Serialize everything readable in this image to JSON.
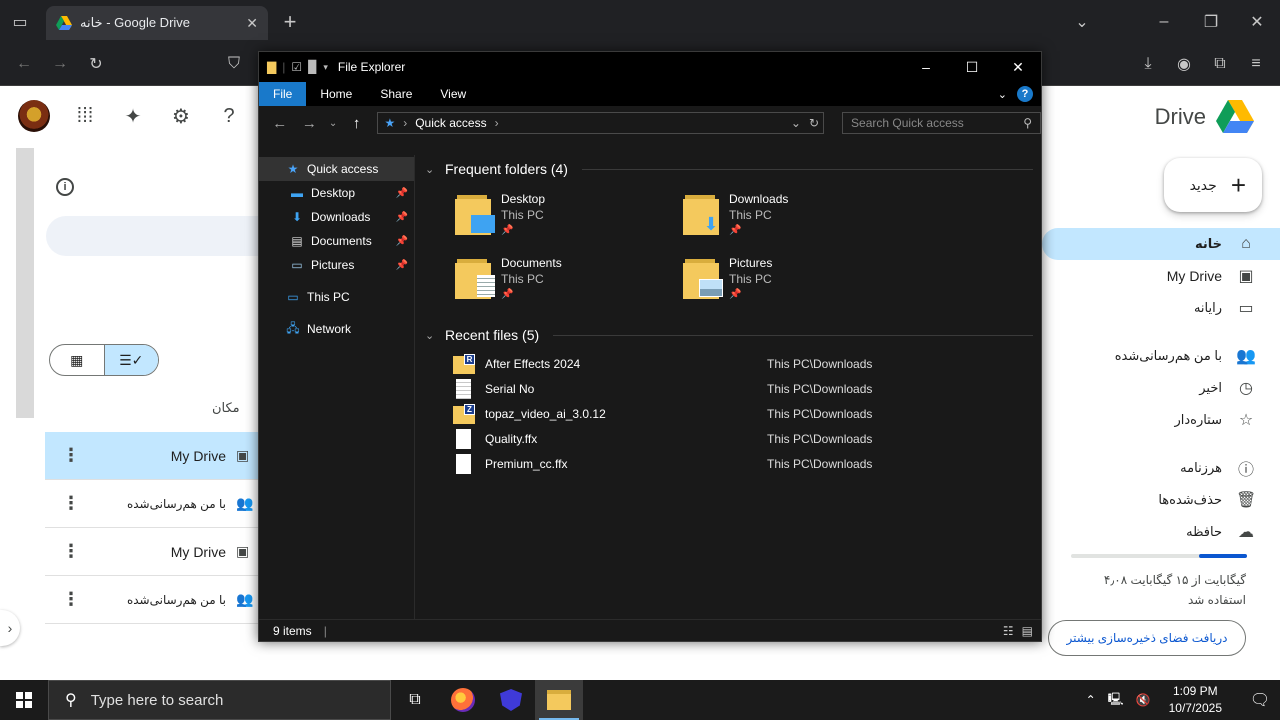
{
  "browser": {
    "tab_title": "خانه - Google Drive",
    "new_tab_symbol": "+"
  },
  "drive": {
    "logo_text": "Drive",
    "new_button_label": "جدید",
    "column_header": "مکان",
    "rows": [
      {
        "location": "My Drive",
        "icon": "drive-icon",
        "selected": true
      },
      {
        "location": "با من هم‌رسانی‌شده",
        "icon": "people-icon",
        "selected": false
      },
      {
        "location": "My Drive",
        "icon": "drive-icon",
        "selected": false
      },
      {
        "location": "با من هم‌رسانی‌شده",
        "icon": "people-icon",
        "selected": false
      }
    ],
    "nav": [
      {
        "label": "خانه",
        "icon": "home-icon",
        "active": true
      },
      {
        "label": "My Drive",
        "icon": "drive-icon",
        "active": false
      },
      {
        "label": "رایانه",
        "icon": "computer-icon",
        "active": false
      },
      {
        "label": "با من هم‌رسانی‌شده",
        "icon": "people-icon",
        "active": false
      },
      {
        "label": "اخیر",
        "icon": "clock-icon",
        "active": false
      },
      {
        "label": "ستاره‌دار",
        "icon": "star-icon",
        "active": false
      },
      {
        "label": "هرزنامه",
        "icon": "spam-icon",
        "active": false
      },
      {
        "label": "حذف‌شده‌ها",
        "icon": "trash-icon",
        "active": false
      },
      {
        "label": "حافظه",
        "icon": "cloud-icon",
        "active": false
      }
    ],
    "storage_used_fraction": 0.27,
    "storage_line1": "۴٫۰۸ گیگابایت از ۱۵ گیگابایت",
    "storage_line2": "استفاده شد",
    "storage_button": "دریافت فضای ذخیره‌سازی بیشتر",
    "accent_color": "#c2e7ff"
  },
  "explorer": {
    "window_title": "File Explorer",
    "ribbon_tabs": [
      "File",
      "Home",
      "Share",
      "View"
    ],
    "address_location": "Quick access",
    "search_placeholder": "Search Quick access",
    "sidebar": [
      {
        "label": "Quick access",
        "icon": "star-icon",
        "pinned": false,
        "selected": true
      },
      {
        "label": "Desktop",
        "icon": "desktop-icon",
        "pinned": true,
        "selected": false
      },
      {
        "label": "Downloads",
        "icon": "download-icon",
        "pinned": true,
        "selected": false
      },
      {
        "label": "Documents",
        "icon": "documents-icon",
        "pinned": true,
        "selected": false
      },
      {
        "label": "Pictures",
        "icon": "pictures-icon",
        "pinned": true,
        "selected": false
      },
      {
        "label": "This PC",
        "icon": "computer-icon",
        "pinned": false,
        "selected": false
      },
      {
        "label": "Network",
        "icon": "network-icon",
        "pinned": false,
        "selected": false
      }
    ],
    "frequent_header": "Frequent folders (4)",
    "frequent_folders": [
      {
        "name": "Desktop",
        "location": "This PC"
      },
      {
        "name": "Downloads",
        "location": "This PC"
      },
      {
        "name": "Documents",
        "location": "This PC"
      },
      {
        "name": "Pictures",
        "location": "This PC"
      }
    ],
    "recent_header": "Recent files (5)",
    "recent_files": [
      {
        "name": "After Effects 2024",
        "path": "This PC\\Downloads",
        "type": "zip-icon",
        "tag": "R"
      },
      {
        "name": "Serial No",
        "path": "This PC\\Downloads",
        "type": "text-file-icon",
        "tag": ""
      },
      {
        "name": "topaz_video_ai_3.0.12",
        "path": "This PC\\Downloads",
        "type": "zip-icon",
        "tag": "Z"
      },
      {
        "name": "Quality.ffx",
        "path": "This PC\\Downloads",
        "type": "file-icon",
        "tag": ""
      },
      {
        "name": "Premium_cc.ffx",
        "path": "This PC\\Downloads",
        "type": "file-icon",
        "tag": ""
      }
    ],
    "status_count": "9 items"
  },
  "taskbar": {
    "search_placeholder": "Type here to search",
    "time": "1:09 PM",
    "date": "10/7/2025"
  }
}
